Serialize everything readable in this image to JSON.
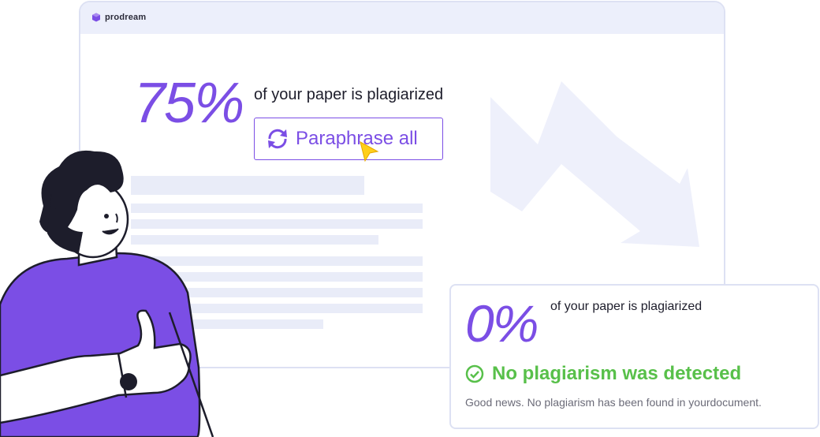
{
  "brand": {
    "name": "prodream",
    "accent": "#7b4ee5"
  },
  "before": {
    "percent": "75%",
    "text": "of your paper is plagiarized",
    "button_label": "Paraphrase all"
  },
  "after": {
    "percent": "0%",
    "text": "of your paper is plagiarized",
    "status": "No plagiarism was detected",
    "message": "Good news. No plagiarism has been found in yourdocument.",
    "status_color": "#58c04a"
  },
  "icons": [
    "logo-cube-icon",
    "refresh-icon",
    "cursor-icon",
    "check-circle-icon",
    "down-trend-arrow-icon"
  ]
}
